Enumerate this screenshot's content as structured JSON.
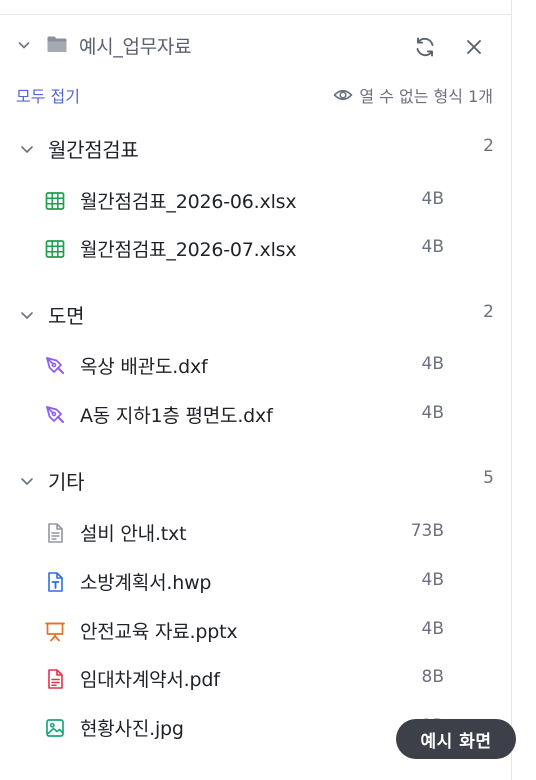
{
  "header": {
    "folder_name": "예시_업무자료"
  },
  "toolbar": {
    "collapse_all_label": "모두 접기",
    "unknown_format_label": "열 수 없는 형식 1개"
  },
  "groups": [
    {
      "label": "월간점검표",
      "count": "2",
      "files": [
        {
          "name": "월간점검표_2026-06.xlsx",
          "size": "4B",
          "icon": "spreadsheet-icon"
        },
        {
          "name": "월간점검표_2026-07.xlsx",
          "size": "4B",
          "icon": "spreadsheet-icon"
        }
      ]
    },
    {
      "label": "도면",
      "count": "2",
      "files": [
        {
          "name": "옥상 배관도.dxf",
          "size": "4B",
          "icon": "pen-tool-icon"
        },
        {
          "name": "A동 지하1층 평면도.dxf",
          "size": "4B",
          "icon": "pen-tool-icon"
        }
      ]
    },
    {
      "label": "기타",
      "count": "5",
      "files": [
        {
          "name": "설비 안내.txt",
          "size": "73B",
          "icon": "text-file-icon"
        },
        {
          "name": "소방계획서.hwp",
          "size": "4B",
          "icon": "document-t-icon"
        },
        {
          "name": "안전교육 자료.pptx",
          "size": "4B",
          "icon": "presentation-icon"
        },
        {
          "name": "임대차계약서.pdf",
          "size": "8B",
          "icon": "pdf-file-icon"
        },
        {
          "name": "현황사진.jpg",
          "size": "2B",
          "icon": "image-file-icon"
        }
      ]
    }
  ],
  "toast": {
    "label": "예시 화면"
  },
  "colors": {
    "accent": "#5466d6",
    "spreadsheet": "#1e9e4f",
    "cad": "#8b5cf6",
    "hwp": "#2f6fe0",
    "pptx": "#e8711c",
    "pdf": "#e0344a",
    "image": "#18a878"
  }
}
